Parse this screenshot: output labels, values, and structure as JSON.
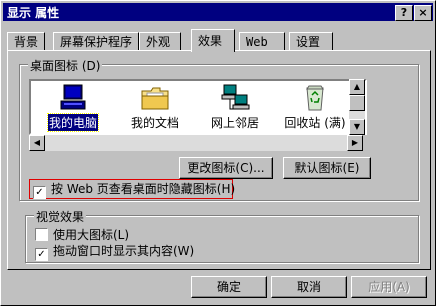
{
  "window": {
    "title": "显示 属性",
    "help_label": "?",
    "close_label": "×"
  },
  "tabs": [
    {
      "label": "背景"
    },
    {
      "label": "屏幕保护程序"
    },
    {
      "label": "外观"
    },
    {
      "label": "效果",
      "active": true
    },
    {
      "label": "Web"
    },
    {
      "label": "设置"
    }
  ],
  "desktop_icons_group": {
    "label": "桌面图标 (D)",
    "items": [
      {
        "label": "我的电脑",
        "icon": "computer-icon",
        "selected": true
      },
      {
        "label": "我的文档",
        "icon": "folder-icon"
      },
      {
        "label": "网上邻居",
        "icon": "network-icon"
      },
      {
        "label": "回收站 (满)",
        "icon": "recycle-bin-icon"
      }
    ],
    "change_icon_label": "更改图标(C)...",
    "default_icon_label": "默认图标(E)"
  },
  "web_checkbox": {
    "label": "按 Web 页查看桌面时隐藏图标(H)",
    "checked": true
  },
  "visual_effects_group": {
    "label": "视觉效果",
    "options": [
      {
        "label": "使用大图标(L)",
        "checked": false
      },
      {
        "label": "拖动窗口时显示其内容(W)",
        "checked": true
      }
    ]
  },
  "footer": {
    "ok_label": "确定",
    "cancel_label": "取消",
    "apply_label": "应用(A)"
  },
  "colors": {
    "titlebar": "#000080",
    "face": "#c0c0c0",
    "highlight_box": "#e00000"
  }
}
